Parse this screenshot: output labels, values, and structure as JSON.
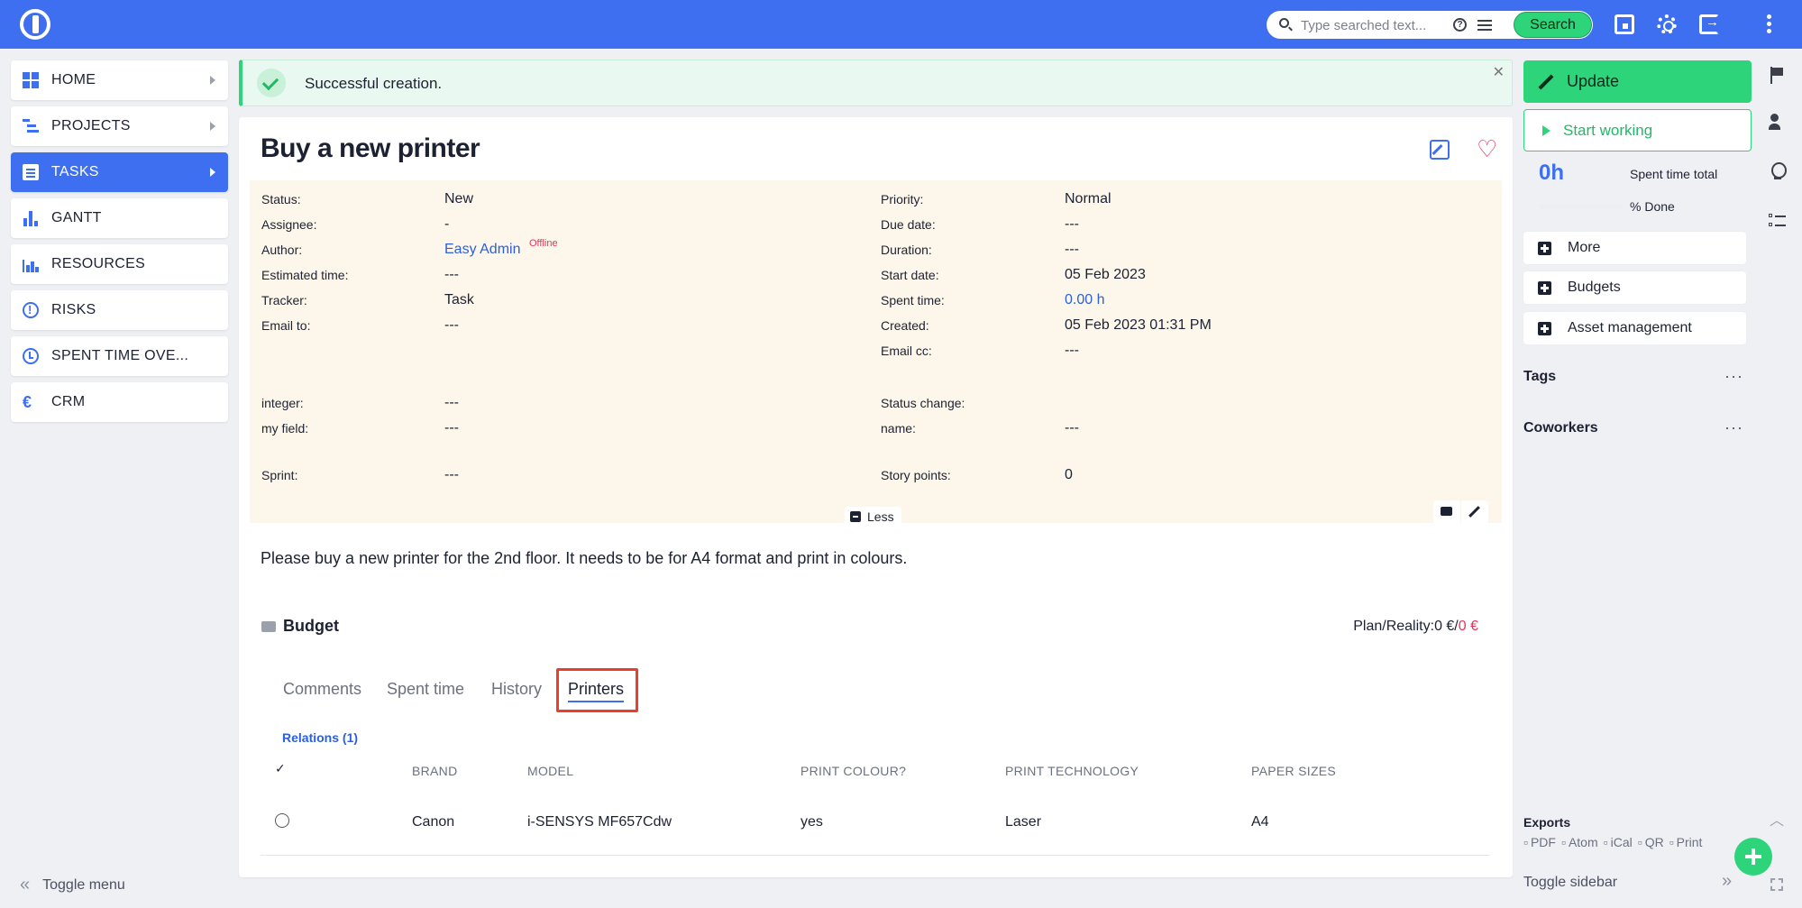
{
  "header": {
    "search_placeholder": "Type searched text...",
    "search_button": "Search"
  },
  "nav": {
    "items": [
      {
        "label": "HOME"
      },
      {
        "label": "PROJECTS"
      },
      {
        "label": "TASKS"
      },
      {
        "label": "GANTT"
      },
      {
        "label": "RESOURCES"
      },
      {
        "label": "RISKS"
      },
      {
        "label": "SPENT TIME OVE..."
      },
      {
        "label": "CRM"
      }
    ],
    "toggle_menu": "Toggle menu"
  },
  "flash": {
    "message": "Successful creation."
  },
  "task": {
    "title": "Buy a new printer",
    "attributes_left": [
      {
        "label": "Status:",
        "value": "New"
      },
      {
        "label": "Assignee:",
        "value": "-"
      },
      {
        "label": "Author:",
        "value": "Easy Admin",
        "badge": "Offline"
      },
      {
        "label": "Estimated time:",
        "value": "---"
      },
      {
        "label": "Tracker:",
        "value": "Task"
      },
      {
        "label": "Email to:",
        "value": "---"
      },
      {
        "label": "integer:",
        "value": "---"
      },
      {
        "label": "my field:",
        "value": "---"
      },
      {
        "label": "Sprint:",
        "value": "---"
      }
    ],
    "attributes_right": [
      {
        "label": "Priority:",
        "value": "Normal"
      },
      {
        "label": "Due date:",
        "value": "---"
      },
      {
        "label": "Duration:",
        "value": "---"
      },
      {
        "label": "Start date:",
        "value": "05 Feb 2023"
      },
      {
        "label": "Spent time:",
        "value": "0.00 h"
      },
      {
        "label": "Created:",
        "value": "05 Feb 2023 01:31 PM"
      },
      {
        "label": "Email cc:",
        "value": "---"
      },
      {
        "label": "Status change:",
        "value": ""
      },
      {
        "label": "name:",
        "value": "---"
      },
      {
        "label": "Story points:",
        "value": "0"
      }
    ],
    "less_label": "Less",
    "description": "Please buy a new printer for the 2nd floor. It needs to be for A4 format and print in colours."
  },
  "budget": {
    "title": "Budget",
    "plan_reality_label": "Plan/Reality:",
    "plan_value": "0 €/",
    "reality_value": "0 €"
  },
  "tabs": [
    {
      "label": "Comments"
    },
    {
      "label": "Spent time"
    },
    {
      "label": "History"
    },
    {
      "label": "Printers"
    }
  ],
  "relations": {
    "title": "Relations (1)",
    "check_header": "✓",
    "columns": [
      "BRAND",
      "MODEL",
      "PRINT COLOUR?",
      "PRINT TECHNOLOGY",
      "PAPER SIZES"
    ],
    "rows": [
      [
        "Canon",
        "i-SENSYS MF657Cdw",
        "yes",
        "Laser",
        "A4"
      ]
    ]
  },
  "sidebar": {
    "update": "Update",
    "start_working": "Start working",
    "spent_total_value": "0h",
    "spent_total_label": "Spent time total",
    "done_label": "% Done",
    "done_percent": 0,
    "boxes": [
      {
        "label": "More"
      },
      {
        "label": "Budgets"
      },
      {
        "label": "Asset management"
      }
    ],
    "tags": "Tags",
    "coworkers": "Coworkers",
    "dots": "···",
    "exports_title": "Exports",
    "exports": [
      "PDF",
      "Atom",
      "iCal",
      "QR",
      "Print"
    ],
    "toggle_sidebar": "Toggle sidebar"
  },
  "colors": {
    "brand": "#3d6ff0",
    "success": "#2ed47a",
    "alert": "#e8335d",
    "attributes_bg": "#fdf6ea"
  }
}
